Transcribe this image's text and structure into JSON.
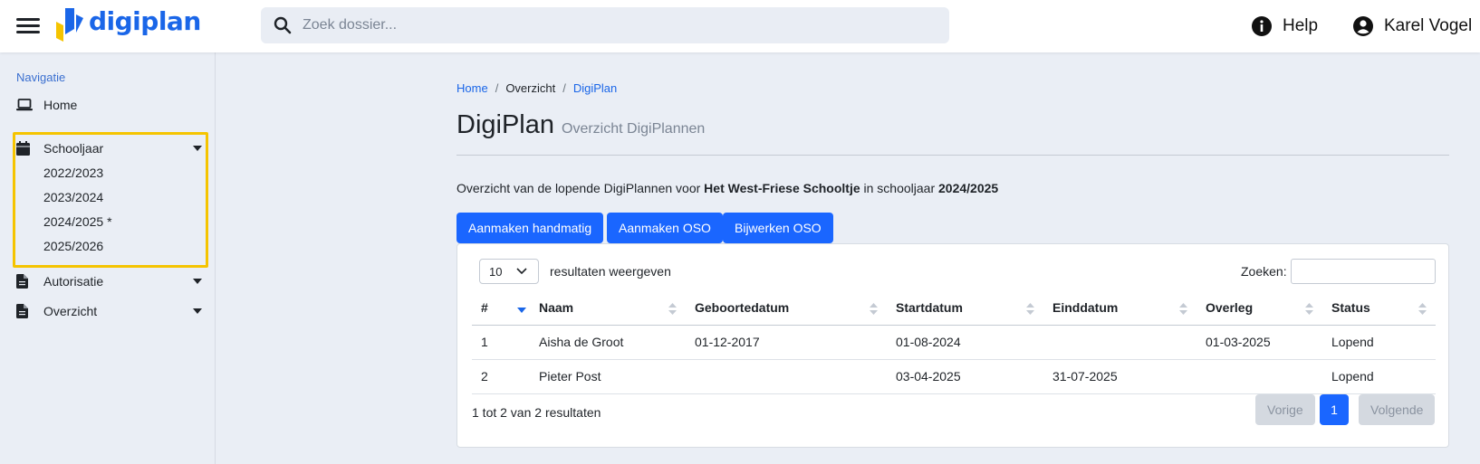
{
  "header": {
    "logo_text": "digiplan",
    "search": {
      "placeholder": "Zoek dossier..."
    },
    "help_label": "Help",
    "user_name": "Karel Vogel"
  },
  "sidebar": {
    "heading": "Navigatie",
    "items": [
      {
        "label": "Home",
        "icon": "laptop-icon"
      },
      {
        "label": "Schooljaar",
        "icon": "calendar-icon",
        "expanded": true,
        "children": [
          "2022/2023",
          "2023/2024",
          "2024/2025 *",
          "2025/2026"
        ]
      },
      {
        "label": "Autorisatie",
        "icon": "file-icon"
      },
      {
        "label": "Overzicht",
        "icon": "file-icon"
      }
    ],
    "highlight_color": "#f5c400"
  },
  "breadcrumb": [
    {
      "label": "Home",
      "link": true
    },
    {
      "label": "Overzicht",
      "link": false
    },
    {
      "label": "DigiPlan",
      "link": true
    }
  ],
  "page": {
    "title": "DigiPlan",
    "subtitle": "Overzicht DigiPlannen",
    "intro_prefix": "Overzicht van de lopende DigiPlannen voor ",
    "school": "Het West-Friese Schooltje",
    "intro_mid": " in schooljaar ",
    "year": "2024/2025"
  },
  "actions": [
    "Aanmaken handmatig",
    "Aanmaken OSO",
    "Bijwerken OSO"
  ],
  "table": {
    "page_length": "10",
    "length_label": "resultaten weergeven",
    "search_label": "Zoeken:",
    "columns": [
      "#",
      "",
      "Naam",
      "Geboortedatum",
      "Startdatum",
      "Einddatum",
      "Overleg",
      "Status"
    ],
    "rows": [
      [
        "1",
        "",
        "Aisha de Groot",
        "01-12-2017",
        "01-08-2024",
        "",
        "01-03-2025",
        "Lopend"
      ],
      [
        "2",
        "",
        "Pieter Post",
        "",
        "03-04-2025",
        "31-07-2025",
        "",
        "Lopend"
      ]
    ],
    "info": "1 tot 2 van 2 resultaten",
    "pagination": {
      "prev": "Vorige",
      "current": "1",
      "next": "Volgende"
    }
  },
  "colors": {
    "accent": "#1a66ff",
    "link": "#1a66e8",
    "background": "#eaeef5"
  }
}
